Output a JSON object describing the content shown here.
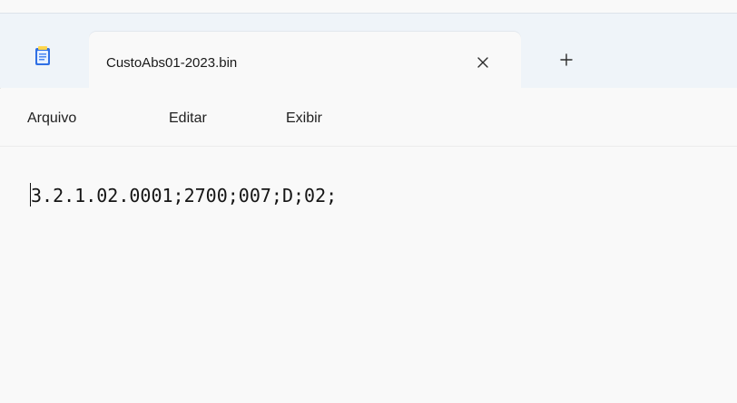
{
  "tab": {
    "title": "CustoAbs01-2023.bin",
    "close_symbol": "×",
    "new_tab_symbol": "+"
  },
  "menu": {
    "items": [
      "Arquivo",
      "Editar",
      "Exibir"
    ]
  },
  "editor": {
    "content": "3.2.1.02.0001;2700;007;D;02;"
  },
  "colors": {
    "titlebar_bg": "#eff4f9",
    "page_bg": "#f9f9f9",
    "icon_blue": "#2f6fe4"
  },
  "icons": {
    "app": "notepad-icon",
    "close": "close-icon",
    "add": "plus-icon"
  }
}
